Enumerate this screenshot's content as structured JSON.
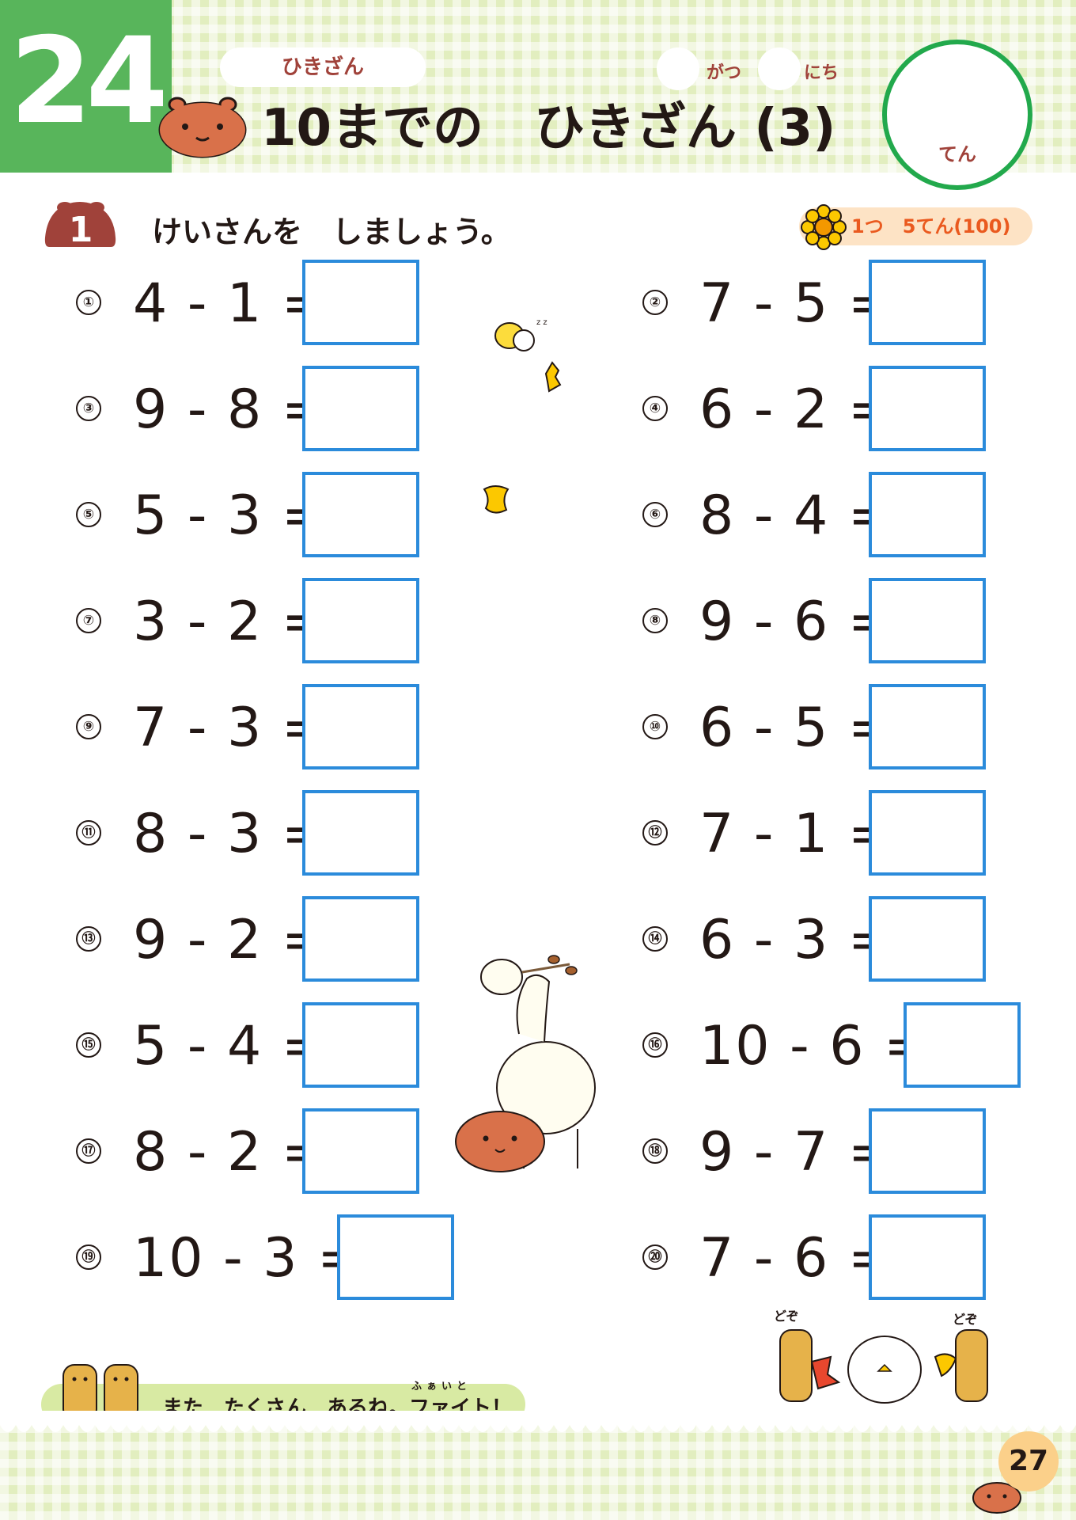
{
  "header": {
    "lesson_number": "24",
    "category": "ひきざん",
    "title": "10までの　ひきざん (3)",
    "date_month_label": "がつ",
    "date_day_label": "にち",
    "score_label": "てん"
  },
  "question": {
    "number": "1",
    "instruction": "けいさんを　しましょう。",
    "points": "1つ　5てん(100)"
  },
  "problems": [
    {
      "num": "①",
      "expr": "4 - 1 ="
    },
    {
      "num": "②",
      "expr": "7 - 5 ="
    },
    {
      "num": "③",
      "expr": "9 - 8 ="
    },
    {
      "num": "④",
      "expr": "6 - 2 ="
    },
    {
      "num": "⑤",
      "expr": "5 - 3 ="
    },
    {
      "num": "⑥",
      "expr": "8 - 4 ="
    },
    {
      "num": "⑦",
      "expr": "3 - 2 ="
    },
    {
      "num": "⑧",
      "expr": "9 - 6 ="
    },
    {
      "num": "⑨",
      "expr": "7 - 3 ="
    },
    {
      "num": "⑩",
      "expr": "6 - 5 ="
    },
    {
      "num": "⑪",
      "expr": "8 - 3 ="
    },
    {
      "num": "⑫",
      "expr": "7 - 1 ="
    },
    {
      "num": "⑬",
      "expr": "9 - 2 ="
    },
    {
      "num": "⑭",
      "expr": "6 - 3 ="
    },
    {
      "num": "⑮",
      "expr": "5 - 4 ="
    },
    {
      "num": "⑯",
      "expr": "10 - 6 ="
    },
    {
      "num": "⑰",
      "expr": "8 - 2 ="
    },
    {
      "num": "⑱",
      "expr": "9 - 7 ="
    },
    {
      "num": "⑲",
      "expr": "10 - 3 ="
    },
    {
      "num": "⑳",
      "expr": "7 - 6 ="
    }
  ],
  "footer": {
    "message": "また　たくさん　あるね。ファイト！",
    "ruby": "ふぁいと",
    "sfx": "どぞ"
  },
  "page_number": "27",
  "colors": {
    "green": "#58b55b",
    "check": "#e2eebf",
    "answer_box": "#2b8bdb",
    "capybara": "#d9714a"
  }
}
